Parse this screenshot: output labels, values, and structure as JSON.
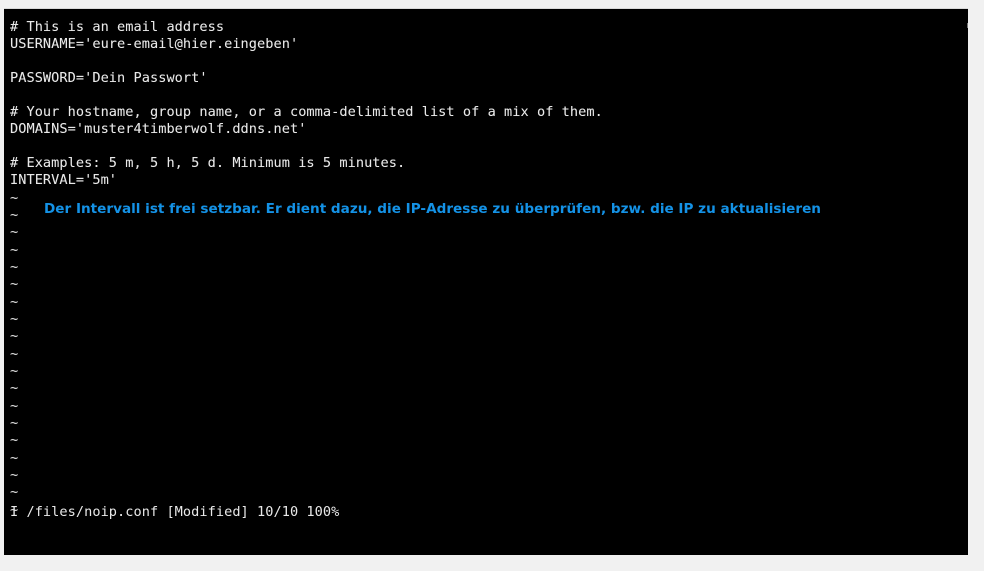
{
  "window": {
    "kind": "terminal-vim-session",
    "background_color": "#000000",
    "page_background_color": "#f1f1f1",
    "text_color": "#e9e9e9",
    "annotation_color": "#1492e6"
  },
  "editor": {
    "file_path": "/files/noip.conf",
    "mode_indicator": "I",
    "modified_flag": "[Modified]",
    "cursor_position": "10/10",
    "scroll_percent": "100%",
    "status_line": "I /files/noip.conf [Modified] 10/10 100%",
    "lines": [
      "# This is an email address",
      "USERNAME='eure-email@hier.eingeben'",
      "",
      "PASSWORD='Dein Passwort'",
      "",
      "# Your hostname, group name, or a comma-delimited list of a mix of them.",
      "DOMAINS='muster4timberwolf.ddns.net'",
      "",
      "# Examples: 5 m, 5 h, 5 d. Minimum is 5 minutes.",
      "INTERVAL='5m'"
    ],
    "empty_line_marker": "~",
    "empty_line_count": 20
  },
  "annotation": {
    "text": "Der Intervall ist frei setzbar. Er dient dazu, die IP-Adresse zu überprüfen, bzw. die IP zu aktualisieren"
  }
}
